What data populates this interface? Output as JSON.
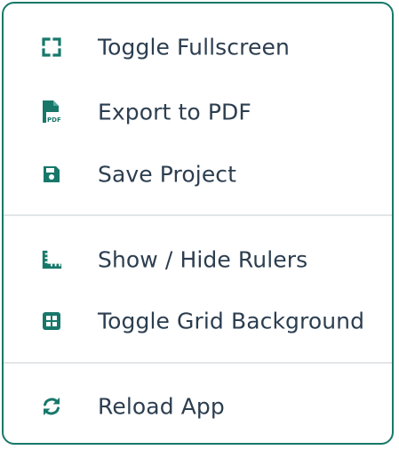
{
  "colors": {
    "border": "#17786a",
    "icon": "#17786a",
    "text": "#2c3e50",
    "divider": "#e3e6e8"
  },
  "menu": {
    "items": [
      {
        "label": "Toggle Fullscreen",
        "icon": "fullscreen-icon"
      },
      {
        "label": "Export to PDF",
        "icon": "pdf-file-icon"
      },
      {
        "label": "Save Project",
        "icon": "save-icon"
      },
      {
        "label": "Show / Hide Rulers",
        "icon": "ruler-icon"
      },
      {
        "label": "Toggle Grid Background",
        "icon": "grid-icon"
      },
      {
        "label": "Reload App",
        "icon": "reload-icon"
      }
    ]
  }
}
